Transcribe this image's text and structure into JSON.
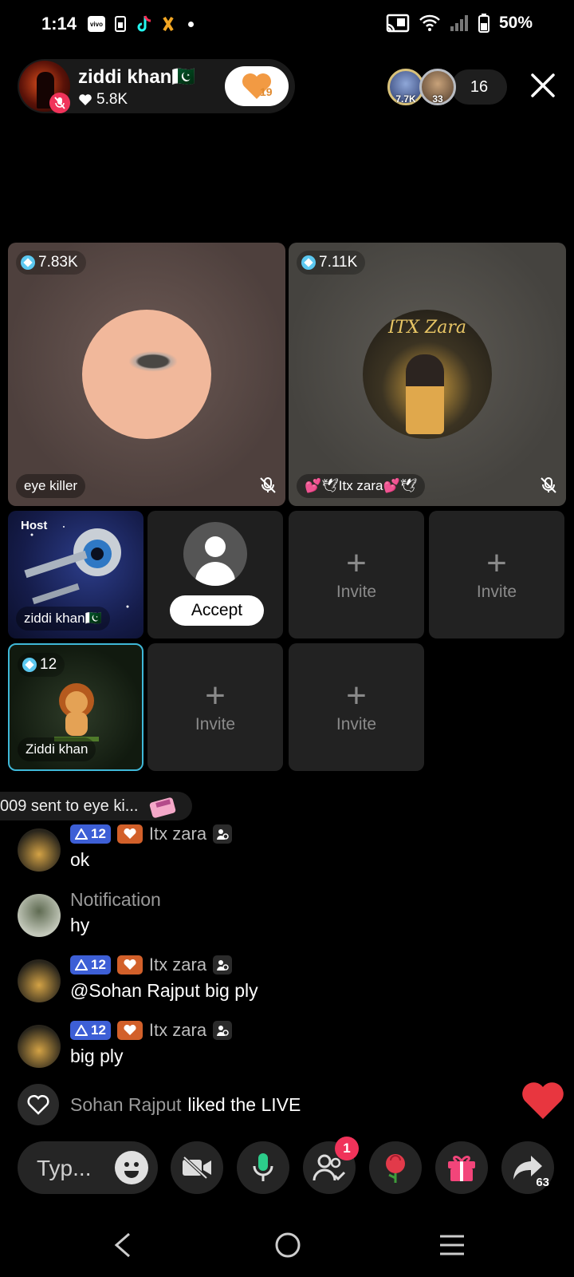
{
  "status_bar": {
    "time": "1:14",
    "apps": [
      "vivo",
      "sim",
      "tiktok",
      "flash"
    ],
    "battery": "50%"
  },
  "header": {
    "host_name": "ziddi khan🇵🇰",
    "host_likes": "5.8K",
    "heart_count": "19",
    "viewer_avatars": [
      {
        "count": "7.7K"
      },
      {
        "count": "33"
      }
    ],
    "viewer_total": "16"
  },
  "guests": {
    "eye_killer": {
      "score": "7.83K",
      "name": "eye killer"
    },
    "itx_zara": {
      "score": "7.11K",
      "name": "💕🕊Itx zara💕🕊",
      "avatar_text": "ITX Zara"
    }
  },
  "seats": {
    "host_label": "Host",
    "host_name": "ziddi khan🇵🇰",
    "accept_label": "Accept",
    "invite_label": "Invite",
    "ziddi": {
      "score": "12",
      "name": "Ziddi khan"
    }
  },
  "gift_banner": {
    "text": "009 sent to eye ki..."
  },
  "comments": [
    {
      "level": "12",
      "user": "Itx zara",
      "text": "ok"
    },
    {
      "title": "Notification",
      "text": "hy"
    },
    {
      "level": "12",
      "user": "Itx zara",
      "text": "@Sohan Rajput big ply"
    },
    {
      "level": "12",
      "user": "Itx zara",
      "text": "big ply"
    }
  ],
  "like_event": {
    "user": "Sohan Rajput",
    "action": "liked the LIVE"
  },
  "bottom_bar": {
    "input_placeholder": "Typ...",
    "friends_badge": "1",
    "share_count": "63"
  },
  "colors": {
    "accent_pink": "#f0335a",
    "level_blue": "#3d5fd6",
    "fan_orange": "#d2602a",
    "heart_red": "#e8363f"
  }
}
